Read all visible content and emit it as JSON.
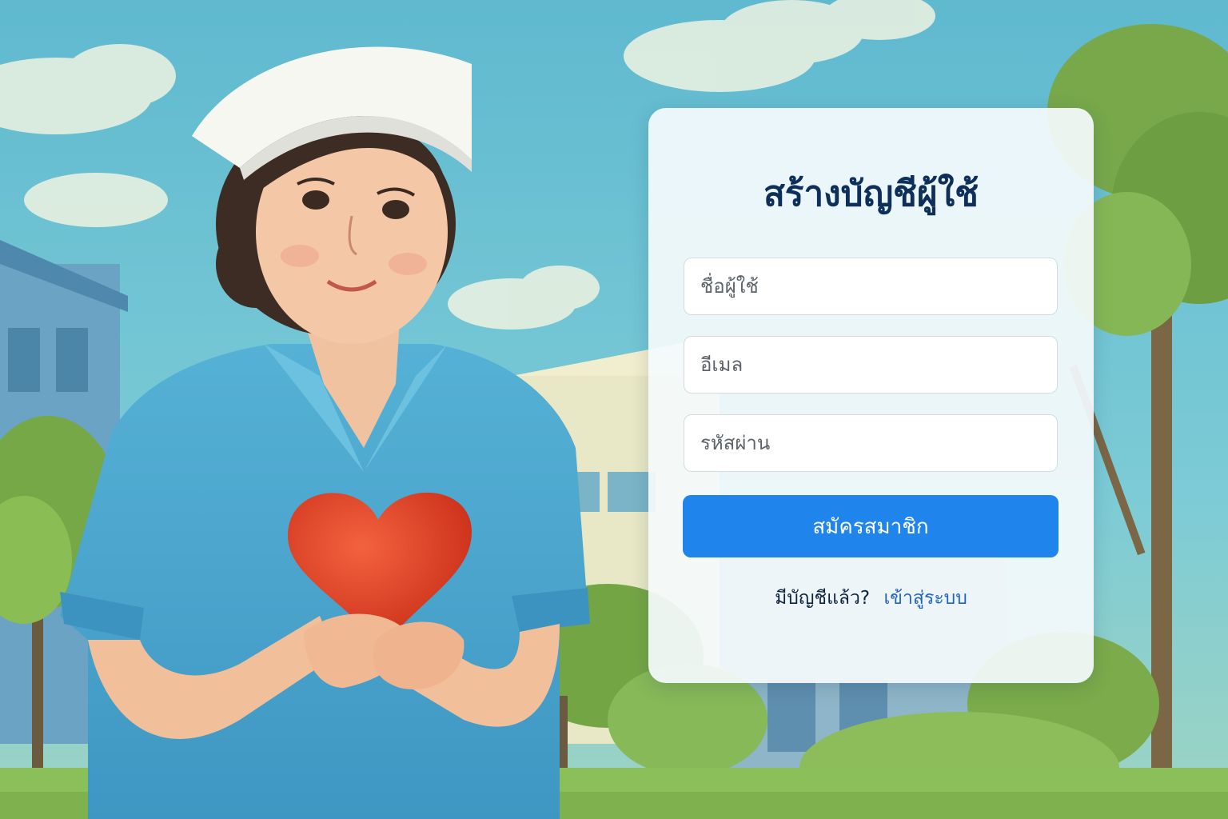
{
  "signup": {
    "title": "สร้างบัญชีผู้ใช้",
    "username_placeholder": "ชื่อผู้ใช้",
    "email_placeholder": "อีเมล",
    "password_placeholder": "รหัสผ่าน",
    "submit_label": "สมัครสมาชิก",
    "login_prompt": "มีบัญชีแล้ว?",
    "login_link": "เข้าสู่ระบบ"
  },
  "colors": {
    "title": "#0f2f5b",
    "primary_button": "#1f84ec",
    "link": "#1f63c6",
    "card_background": "#f4fafc"
  },
  "illustration": {
    "subject": "nurse-holding-heart",
    "setting": "hospital-garden"
  }
}
